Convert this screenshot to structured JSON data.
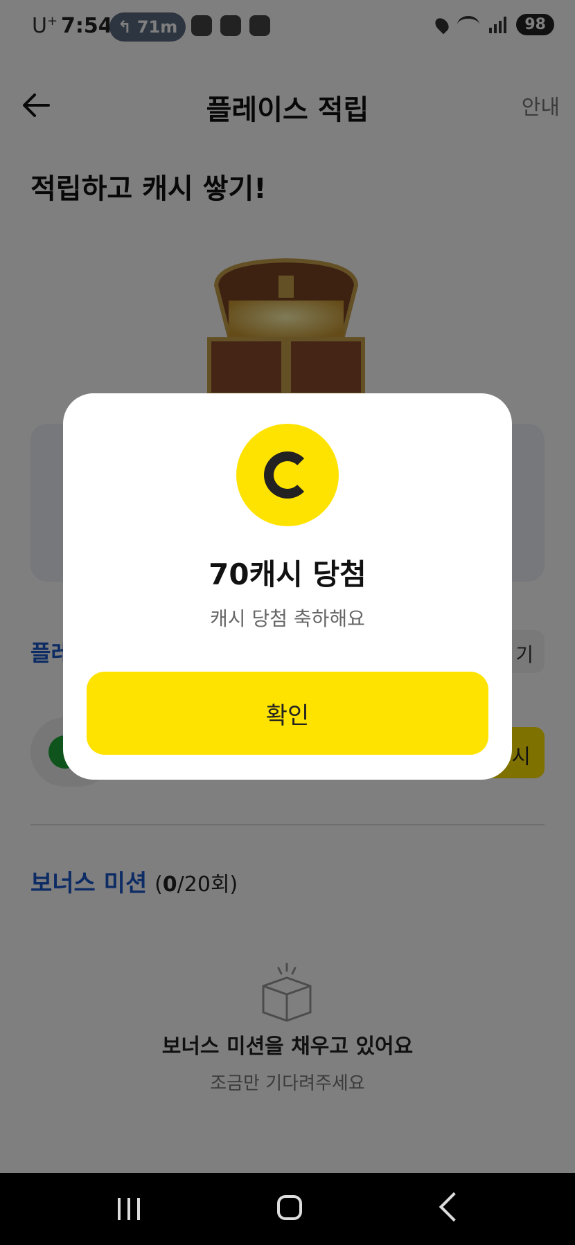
{
  "status_bar": {
    "carrier": "U",
    "carrier_sup": "+",
    "time": "7:54",
    "nav_chip": "71m",
    "battery": "98"
  },
  "header": {
    "title": "플레이스 적립",
    "guide_link": "안내"
  },
  "headline": "적립하고 캐시 쌓기!",
  "section": {
    "title_partial": "플레",
    "view_button_partial": "기",
    "yellow_button_partial": "시"
  },
  "bonus": {
    "title": "보너스 미션",
    "count_open": "(",
    "count_done": "0",
    "count_rest": "/20회)"
  },
  "empty_state": {
    "title": "보너스 미션을 채우고 있어요",
    "subtitle": "조금만 기다려주세요"
  },
  "modal": {
    "title": "70캐시 당첨",
    "subtitle": "캐시 당첨 축하해요",
    "confirm_label": "확인"
  },
  "colors": {
    "accent_yellow": "#ffe300",
    "link_blue": "#1a56c8"
  }
}
